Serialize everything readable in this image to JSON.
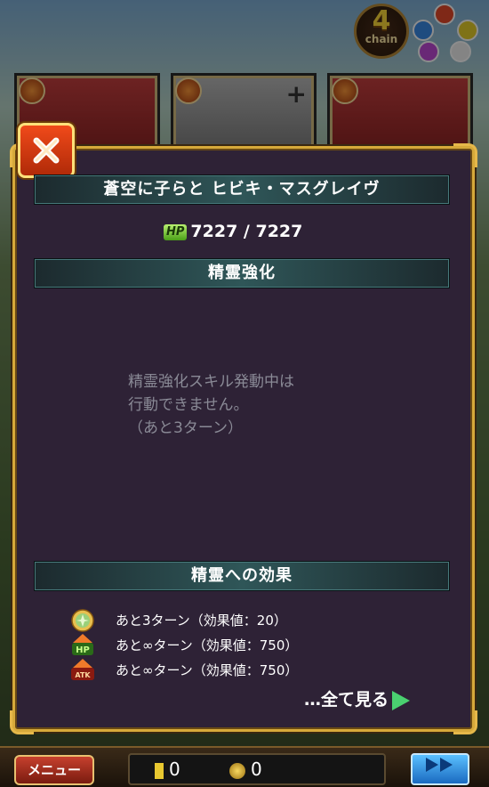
{
  "game": {
    "chain_count": "4",
    "chain_label": "chain",
    "orb_colors": [
      "#e84a2a",
      "#3a8ae8",
      "#e8d02a",
      "#c04ad8",
      "#f0f0f0"
    ]
  },
  "cards": [
    {
      "element": "fire-icon",
      "style": "red"
    },
    {
      "element": "fire-icon",
      "style": "gray",
      "plus": "+"
    },
    {
      "element": "fire-icon",
      "style": "red"
    }
  ],
  "modal": {
    "character_name": "蒼空に子らと ヒビキ・マスグレイヴ",
    "hp_label": "HP",
    "hp_value": "7227 / 7227",
    "section_title": "精霊強化",
    "notice_line1": "精霊強化スキル発動中は",
    "notice_line2": "行動できません。",
    "notice_line3": "（あと3ターン）",
    "effects_title": "精霊への効果",
    "effects": [
      {
        "icon": "clover-badge-icon",
        "text": "あと3ターン（効果値：20）"
      },
      {
        "icon": "hp-up-icon",
        "icon_label": "HP",
        "text": "あと∞ターン（効果値：750）"
      },
      {
        "icon": "atk-up-icon",
        "icon_label": "ATK",
        "text": "あと∞ターン（効果値：750）"
      }
    ],
    "see_all": "…全て見る"
  },
  "bottom": {
    "menu_label": "メニュー",
    "gem_count": "0",
    "coin_count": "0"
  },
  "colors": {
    "modal_bg": "#2e2236",
    "frame_gold": "#d6a93a",
    "header_teal": "#2f5658"
  }
}
